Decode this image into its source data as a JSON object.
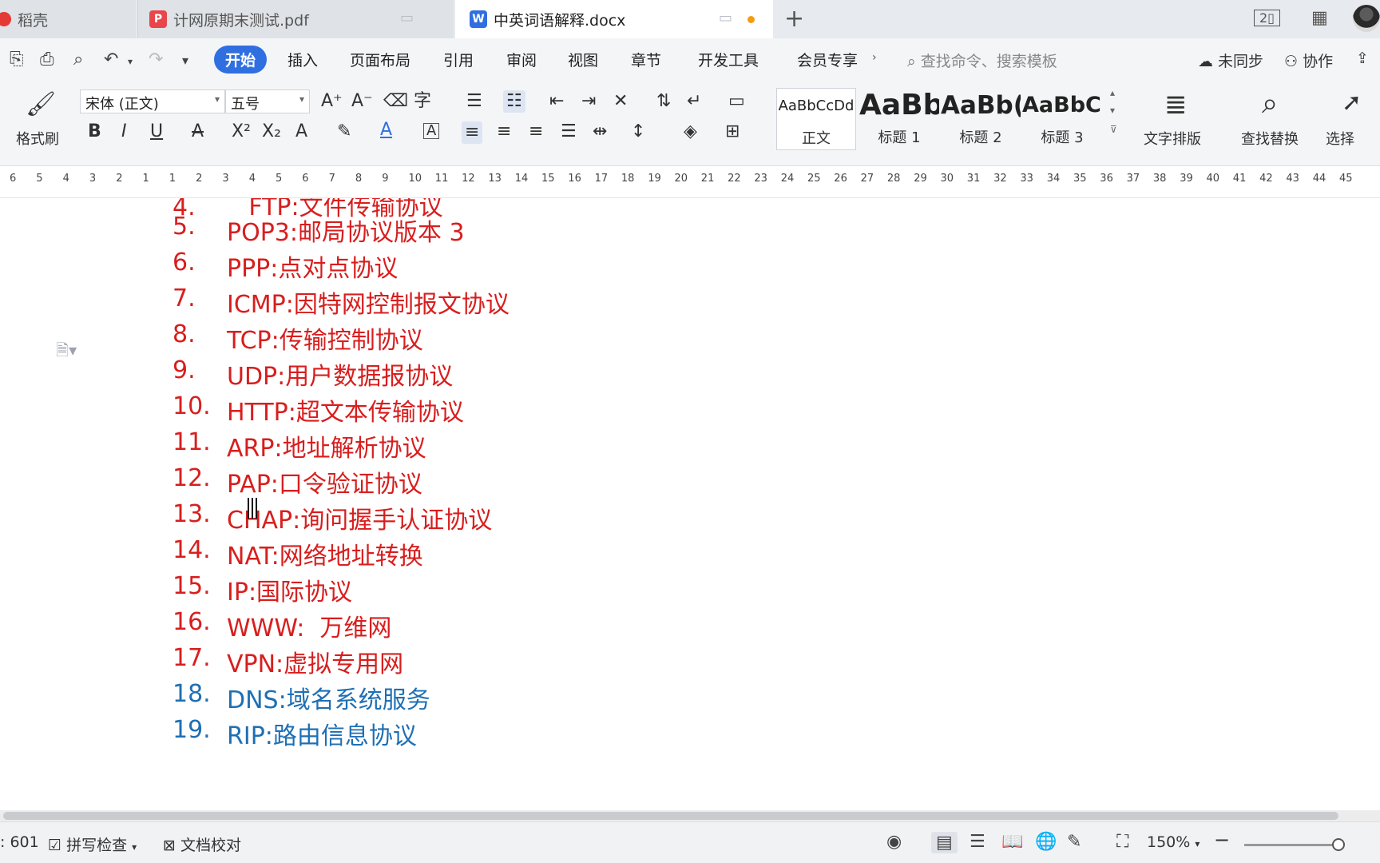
{
  "tabs": [
    {
      "label": "稻壳",
      "type": "home"
    },
    {
      "label": "计网原期末测试.pdf",
      "type": "pdf"
    },
    {
      "label": "中英词语解释.docx",
      "type": "docx",
      "active": true
    }
  ],
  "menu": {
    "items": [
      "开始",
      "插入",
      "页面布局",
      "引用",
      "审阅",
      "视图",
      "章节",
      "开发工具",
      "会员专享"
    ],
    "active": "开始",
    "search_placeholder": "查找命令、搜索模板",
    "sync": "未同步",
    "collab": "协作"
  },
  "ribbon": {
    "format_painter": "格式刷",
    "font_name": "宋体 (正文)",
    "font_size": "五号",
    "styles": [
      {
        "sample": "AaBbCcDd",
        "name": "正文"
      },
      {
        "sample": "AaBb",
        "name": "标题 1"
      },
      {
        "sample": "AaBb(",
        "name": "标题 2"
      },
      {
        "sample": "AaBbC(",
        "name": "标题 3"
      }
    ],
    "text_layout": "文字排版",
    "find_replace": "查找替换",
    "select": "选择"
  },
  "ruler_numbers": [
    "6",
    "5",
    "4",
    "3",
    "2",
    "1",
    "1",
    "2",
    "3",
    "4",
    "5",
    "6",
    "7",
    "8",
    "9",
    "10",
    "11",
    "12",
    "13",
    "14",
    "15",
    "16",
    "17",
    "18",
    "19",
    "20",
    "21",
    "22",
    "23",
    "24",
    "25",
    "26",
    "27",
    "28",
    "29",
    "30",
    "31",
    "32",
    "33",
    "34",
    "35",
    "36",
    "37",
    "38",
    "39",
    "40",
    "41",
    "42",
    "43",
    "44",
    "45"
  ],
  "document": {
    "list": [
      {
        "num": "5.",
        "text": "POP3:邮局协议版本 3",
        "color": "#d81e1e"
      },
      {
        "num": "6.",
        "text": "PPP:点对点协议",
        "color": "#d81e1e"
      },
      {
        "num": "7.",
        "text": "ICMP:因特网控制报文协议",
        "color": "#d81e1e"
      },
      {
        "num": "8.",
        "text": "TCP:传输控制协议",
        "color": "#d81e1e"
      },
      {
        "num": "9.",
        "text": "UDP:用户数据报协议",
        "color": "#d81e1e"
      },
      {
        "num": "10.",
        "text": "HTTP:超文本传输协议",
        "color": "#d81e1e"
      },
      {
        "num": "11.",
        "text": "ARP:地址解析协议",
        "color": "#d81e1e"
      },
      {
        "num": "12.",
        "text": "PAP:口令验证协议",
        "color": "#d81e1e"
      },
      {
        "num": "13.",
        "text": "CHAP:询问握手认证协议",
        "color": "#d81e1e"
      },
      {
        "num": "14.",
        "text": "NAT:网络地址转换",
        "color": "#d81e1e"
      },
      {
        "num": "15.",
        "text": "IP:国际协议",
        "color": "#d81e1e"
      },
      {
        "num": "16.",
        "text": "WWW:  万维网",
        "color": "#d81e1e"
      },
      {
        "num": "17.",
        "text": "VPN:虚拟专用网",
        "color": "#d81e1e"
      },
      {
        "num": "18.",
        "text": "DNS:域名系统服务",
        "color": "#1e6fb4"
      },
      {
        "num": "19.",
        "text": "RIP:路由信息协议",
        "color": "#1e6fb4"
      }
    ]
  },
  "status": {
    "word_count": ": 601",
    "spell_check": "拼写检查",
    "doc_check": "文档校对",
    "zoom": "150%"
  }
}
